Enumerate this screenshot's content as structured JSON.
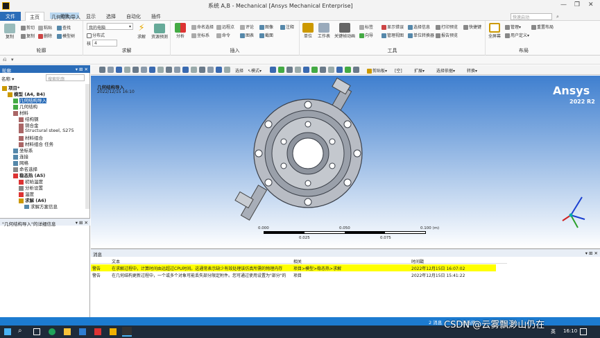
{
  "window": {
    "title": "系统 A,B - Mechanical [Ansys Mechanical Enterprise]",
    "environment_badge": "环境"
  },
  "tabs": [
    "文件",
    "主页",
    "几何结构导入",
    "显示",
    "选择",
    "自动化",
    "插件"
  ],
  "search_placeholder": "快速启动",
  "ribbon": {
    "groups": [
      "轮廓",
      "求解",
      "插入",
      "工具",
      "布局"
    ],
    "outline": {
      "items": [
        "剪切",
        "复制",
        "粘贴",
        "删除",
        "查找",
        "模型树"
      ],
      "big": "复制"
    },
    "solve": {
      "dropdown": "我的电脑",
      "distributed": "分布式",
      "cores_label": "核",
      "cores_value": "4",
      "solve_label": "求解",
      "resource_label": "资源预测"
    },
    "insert": {
      "analysis": "分析",
      "items": [
        "命名选择",
        "远程点",
        "评论",
        "图像",
        "注释",
        "坐标系",
        "命令",
        "图表",
        "截面"
      ]
    },
    "tools": {
      "items": [
        "单位",
        "工作表",
        "关键帧动画",
        "标签",
        "显示错误",
        "选择信息",
        "打印预览",
        "快捷键",
        "向导",
        "管理视图",
        "单位转换器",
        "报告预览"
      ]
    },
    "layout": {
      "full_screen": "全屏幕",
      "manage": "管理",
      "user_defined": "用户定义",
      "reset": "重置布局"
    }
  },
  "left_pane": {
    "outline_title": "轮廓",
    "name_label": "名称",
    "search_placeholder": "搜索轮廓",
    "tree": [
      {
        "label": "项目*",
        "level": 0,
        "bold": true,
        "icon": "project-icon"
      },
      {
        "label": "模型 (A4, B4)",
        "level": 1,
        "bold": true,
        "icon": "model-icon"
      },
      {
        "label": "几何结构导入",
        "level": 2,
        "selected": true,
        "icon": "geometry-import-icon"
      },
      {
        "label": "几何结构",
        "level": 2,
        "icon": "geometry-icon"
      },
      {
        "label": "材料",
        "level": 2,
        "icon": "materials-icon"
      },
      {
        "label": "结构钢",
        "level": 3,
        "icon": "material-icon"
      },
      {
        "label": "铜合金",
        "level": 3,
        "icon": "material-icon"
      },
      {
        "label": "Structural steel, S275",
        "level": 3,
        "icon": "material-icon"
      },
      {
        "label": "材料组合",
        "level": 3,
        "icon": "material-icon"
      },
      {
        "label": "材料组合 任务",
        "level": 3,
        "icon": "material-icon"
      },
      {
        "label": "坐标系",
        "level": 2,
        "icon": "coordinate-icon"
      },
      {
        "label": "连接",
        "level": 2,
        "icon": "connection-icon"
      },
      {
        "label": "网格",
        "level": 2,
        "icon": "mesh-icon"
      },
      {
        "label": "命名选择",
        "level": 2,
        "icon": "named-selection-icon"
      },
      {
        "label": "稳态热 (A5)",
        "level": 2,
        "bold": true,
        "icon": "thermal-icon"
      },
      {
        "label": "初始温度",
        "level": 3,
        "icon": "temperature-icon"
      },
      {
        "label": "分析设置",
        "level": 3,
        "icon": "settings-icon"
      },
      {
        "label": "温度",
        "level": 3,
        "icon": "temperature-icon"
      },
      {
        "label": "求解 (A6)",
        "level": 3,
        "bold": true,
        "icon": "solution-icon"
      },
      {
        "label": "求解方案信息",
        "level": 4,
        "icon": "info-icon"
      }
    ],
    "details_title": "\"几何结构导入\"的详细信息"
  },
  "graphics_toolbar": {
    "select_label": "选择",
    "mode_label": "模式",
    "clipboard_label": "剪贴板",
    "empty_label": "[空]",
    "extend_label": "扩展",
    "select_by_label": "选择依据",
    "convert_label": "转换"
  },
  "viewport": {
    "object_title": "几何结构导入",
    "timestamp": "2022/12/15 16:10",
    "brand": "Ansys",
    "version": "2022 R2",
    "scale_ticks_top": [
      "0.000",
      "0.050",
      "0.100 (m)"
    ],
    "scale_ticks_bottom": [
      "0.025",
      "0.075"
    ]
  },
  "messages": {
    "title": "消息",
    "columns": [
      "文本",
      "相关",
      "时间戳"
    ],
    "rows": [
      {
        "type": "警告",
        "text": "在求解过程中，计算时间由远超过CPU时间。这通常表示缺少有效处理该仿真所需的物理内存",
        "related": "项目>模型>稳态热>求解",
        "time": "2022年12月15日 16:07:02",
        "highlight": true
      },
      {
        "type": "警告",
        "text": "在几何结构更新过程中，一个或多个对象可能丢失部分限定附件。您可通过使用设置为\"部分\"的",
        "related": "项目",
        "time": "2022年12月15日 15:41:22",
        "highlight": false
      }
    ]
  },
  "status": {
    "messages_label": "2 消息",
    "no_selection": "无选择"
  },
  "taskbar": {
    "lang": "英",
    "time": "16:10",
    "watermark": "CSDN @云雾飘渺山仍在"
  },
  "colors": {
    "accent": "#2a6cb8",
    "highlight_row": "#ffff00",
    "viewport_top": "#3f7fcf"
  }
}
